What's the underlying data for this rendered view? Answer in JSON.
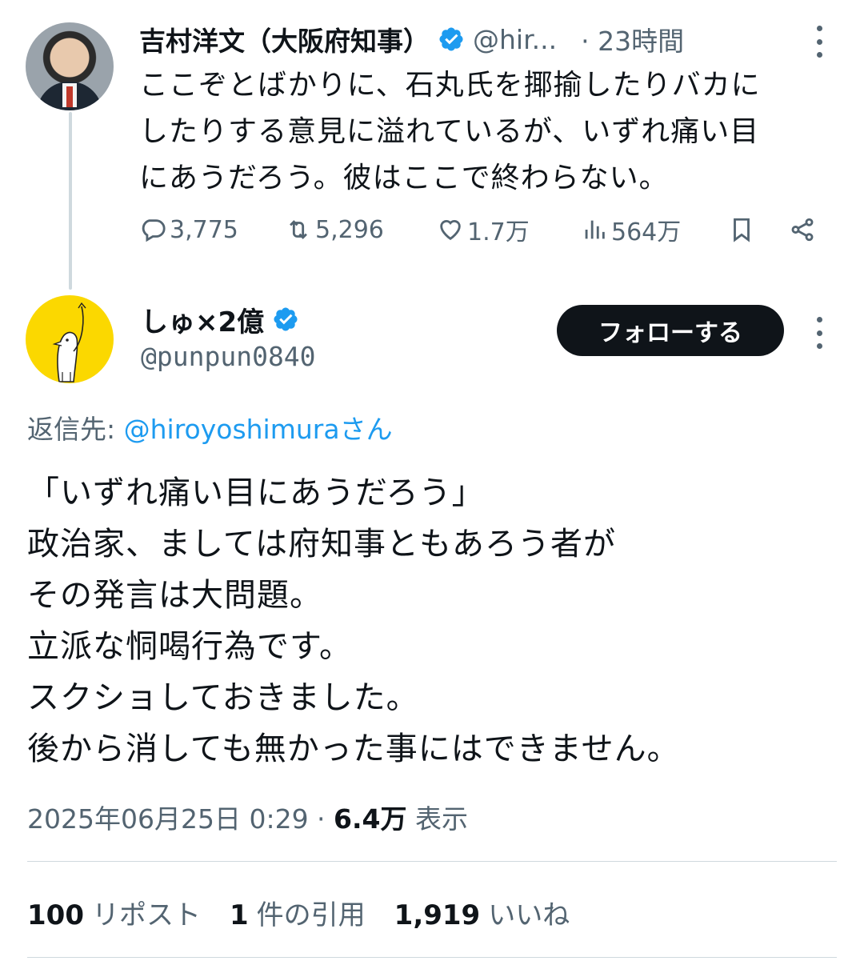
{
  "parent": {
    "name": "吉村洋文（大阪府知事）",
    "handle": "@hir...",
    "time": "· 23時間",
    "text_lines": [
      "ここぞとばかりに、石丸氏を揶揄したりバカに",
      "したりする意見に溢れているが、いずれ痛い目",
      "にあうだろう。彼はここで終わらない。"
    ],
    "actions": {
      "replies": "3,775",
      "retweets": "5,296",
      "likes": "1.7万",
      "views": "564万"
    }
  },
  "reply": {
    "name": "しゅ×2億",
    "handle": "@punpun0840",
    "follow_label": "フォローする",
    "reply_to_label": "返信先: ",
    "reply_to_mention": "@hiroyoshimuraさん",
    "text_lines": [
      "「いずれ痛い目にあうだろう」",
      "政治家、ましては府知事ともあろう者が",
      "その発言は大問題。",
      "立派な恫喝行為です。",
      "スクショしておきました。",
      "後から消しても無かった事にはできません。"
    ],
    "timestamp": "2025年06月25日 0:29 · ",
    "views_count": "6.4万",
    "views_label": " 表示",
    "stats": {
      "reposts_count": "100",
      "reposts_label": "リポスト",
      "quotes_count": "1",
      "quotes_label": "件の引用",
      "likes_count": "1,919",
      "likes_label": "いいね"
    }
  },
  "colors": {
    "text": "#0f1419",
    "secondary": "#536471",
    "accent": "#1d9bf0",
    "avatar_yellow": "#fbd800"
  },
  "icons": [
    "verified-badge-icon",
    "reply-icon",
    "retweet-icon",
    "like-icon",
    "views-icon",
    "bookmark-icon",
    "share-icon",
    "more-icon"
  ]
}
